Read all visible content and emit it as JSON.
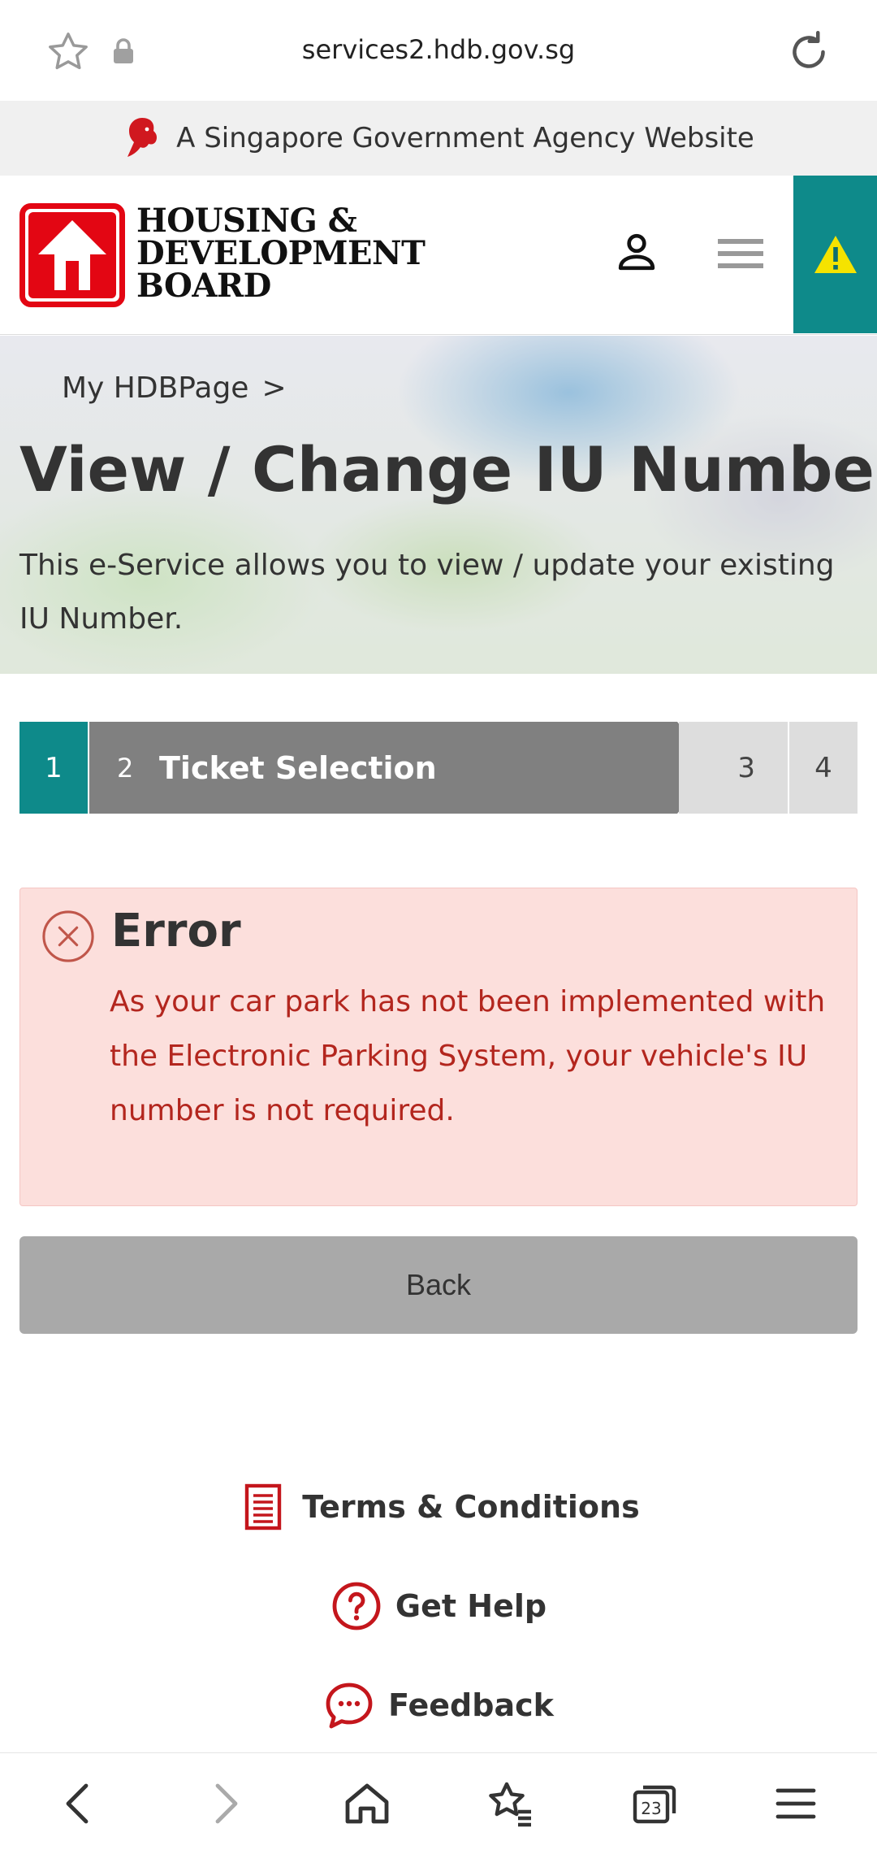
{
  "browser": {
    "url": "services2.hdb.gov.sg",
    "tab_count": "23"
  },
  "gov_banner": {
    "text": "A Singapore Government Agency Website"
  },
  "header": {
    "logo_lines": [
      "HOUSING &",
      "DEVELOPMENT",
      "BOARD"
    ]
  },
  "hero": {
    "breadcrumb": "My HDBPage",
    "breadcrumb_separator": ">",
    "title": "View / Change IU Number",
    "description": "This e-Service allows you to view / update your existing IU Number."
  },
  "stepper": {
    "steps": [
      {
        "number": "1"
      },
      {
        "number": "2",
        "label": "Ticket Selection"
      },
      {
        "number": "3"
      },
      {
        "number": "4"
      }
    ]
  },
  "error": {
    "title": "Error",
    "message": "As your car park has not been implemented with the Electronic Parking System, your vehicle's IU number is not required."
  },
  "actions": {
    "back_label": "Back"
  },
  "footer": {
    "terms_label": "Terms & Conditions",
    "help_label": "Get Help",
    "feedback_label": "Feedback"
  },
  "colors": {
    "teal": "#0e8a8a",
    "brand_red": "#e30613",
    "error_bg": "#fcdfdc",
    "error_text": "#b3261e"
  }
}
